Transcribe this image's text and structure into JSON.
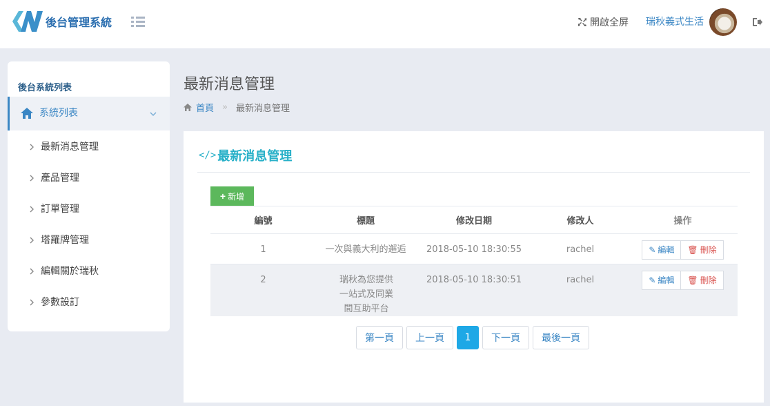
{
  "header": {
    "logo_text": "後台管理系統",
    "fullscreen_label": "開啟全屏",
    "username": "瑞秋義式生活"
  },
  "sidebar": {
    "title": "後台系統列表",
    "group_label": "系統列表",
    "items": [
      {
        "label": "最新消息管理"
      },
      {
        "label": "產品管理"
      },
      {
        "label": "訂單管理"
      },
      {
        "label": "塔羅牌管理"
      },
      {
        "label": "編輯關於瑞秋"
      },
      {
        "label": "參數設訂"
      }
    ]
  },
  "page": {
    "title": "最新消息管理",
    "breadcrumb_home": "首頁",
    "breadcrumb_sep": "»",
    "breadcrumb_current": "最新消息管理"
  },
  "card": {
    "title": "最新消息管理",
    "add_label": "新增",
    "columns": [
      "編號",
      "標題",
      "修改日期",
      "修改人",
      "操作"
    ],
    "rows": [
      {
        "id": "1",
        "title": "一次與義大利的邂逅",
        "date": "2018-05-10 18:30:55",
        "editor": "rachel"
      },
      {
        "id": "2",
        "title": "瑞秋為您提供一站式及同業間互助平台",
        "date": "2018-05-10 18:30:51",
        "editor": "rachel"
      }
    ],
    "edit_label": "編輯",
    "delete_label": "刪除"
  },
  "pagination": {
    "first": "第一頁",
    "prev": "上一頁",
    "current": "1",
    "next": "下一頁",
    "last": "最後一頁"
  },
  "colors": {
    "brand_blue": "#2c6fb0",
    "link_blue": "#3a86c4",
    "title_teal": "#27b0c8",
    "add_green": "#5cb85c",
    "delete_red": "#d9534f",
    "page_active": "#1ea8e6"
  }
}
